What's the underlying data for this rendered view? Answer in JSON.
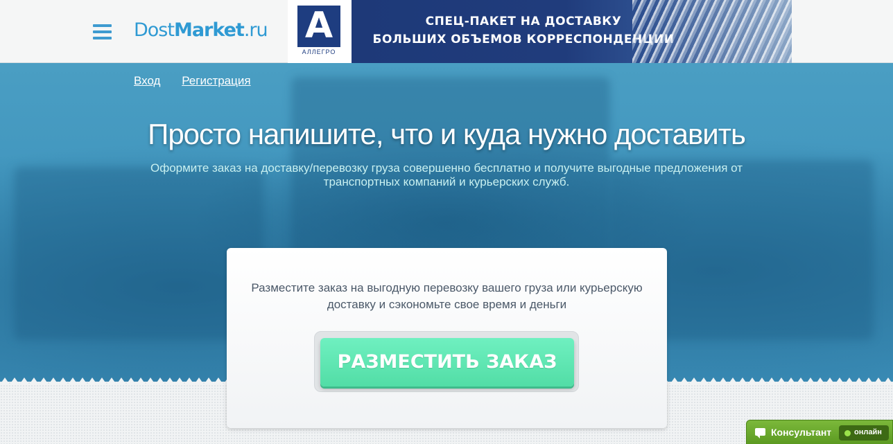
{
  "header": {
    "logo_part1": "Dost",
    "logo_part2": "Market",
    "logo_part3": ".ru",
    "menu_icon": "hamburger-menu-icon"
  },
  "banner": {
    "brand_letter": "А",
    "brand_name": "АЛЛЕГРО",
    "line1": "СПЕЦ-ПАКЕТ НА ДОСТАВКУ",
    "line2": "БОЛЬШИХ ОБЪЕМОВ КОРРЕСПОНДЕНЦИИ"
  },
  "auth": {
    "login": "Вход",
    "register": "Регистрация"
  },
  "hero": {
    "title": "Просто напишите, что и куда нужно доставить",
    "subtitle": "Оформите заказ на доставку/перевозку груза совершенно бесплатно и получите выгодные предложения от транспортных компаний и курьерских служб."
  },
  "card": {
    "text": "Разместите заказ на выгодную перевозку вашего груза или курьерскую доставку и сэкономьте свое время и деньги",
    "button_label": "РАЗМЕСТИТЬ ЗАКАЗ"
  },
  "consultant": {
    "label": "Консультант",
    "status": "онлайн",
    "status_color": "#9be34a",
    "icon": "chat-bubble-icon"
  },
  "colors": {
    "brand": "#2f9ad3",
    "hero_bg": "#4a9ec3",
    "cta": "#52dda6"
  }
}
